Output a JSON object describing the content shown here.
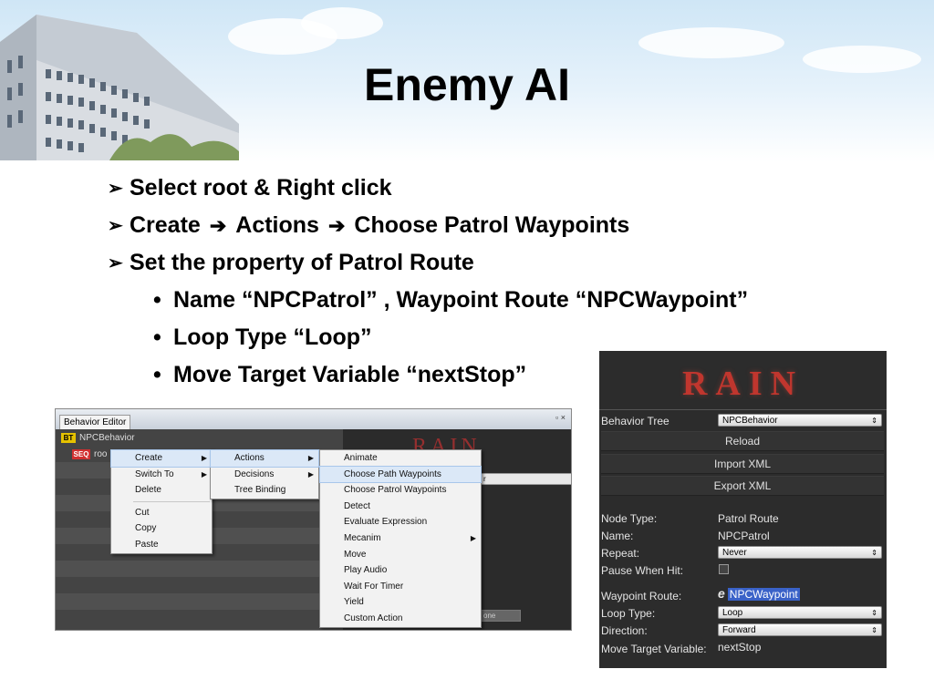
{
  "slide": {
    "title": "Enemy AI",
    "bullets": [
      {
        "text": "Select root & Right click"
      },
      {
        "parts": [
          "Create",
          "Actions",
          "Choose Patrol Waypoints"
        ]
      },
      {
        "text": "Set the property of Patrol Route"
      }
    ],
    "subbullets": [
      "Name “NPCPatrol” , Waypoint Route “NPCWaypoint”",
      "Loop Type “Loop”",
      "Move Target Variable “nextStop”"
    ]
  },
  "editor": {
    "tab": "Behavior Editor",
    "window_controls": "▫ ×",
    "root_icon": "BT",
    "root_label": "NPCBehavior",
    "child_icon": "SEQ",
    "child_label": "roo",
    "menu1": {
      "items": [
        "Create",
        "Switch To",
        "Delete"
      ],
      "items2": [
        "Cut",
        "Copy",
        "Paste"
      ]
    },
    "menu2": {
      "items": [
        "Actions",
        "Decisions",
        "Tree Binding"
      ]
    },
    "menu3": {
      "items": [
        "Animate",
        "Choose Path Waypoints",
        "Choose Patrol Waypoints",
        "Detect",
        "Evaluate Expression",
        "Mecanim",
        "Move",
        "Play Audio",
        "Wait For Timer",
        "Yield",
        "Custom Action"
      ]
    },
    "bg_logo": "RAIN",
    "bg_dropdown": "r",
    "bg_footer": "one"
  },
  "inspector": {
    "logo": "RAIN",
    "behavior_tree_label": "Behavior Tree",
    "behavior_tree_value": "NPCBehavior",
    "reload": "Reload",
    "import_xml": "Import XML",
    "export_xml": "Export XML",
    "node_type_label": "Node Type:",
    "node_type_value": "Patrol Route",
    "name_label": "Name:",
    "name_value": "NPCPatrol",
    "repeat_label": "Repeat:",
    "repeat_value": "Never",
    "pause_label": "Pause When Hit:",
    "pause_checked": false,
    "waypoint_label": "Waypoint Route:",
    "waypoint_icon": "e",
    "waypoint_value": "NPCWaypoint",
    "loop_label": "Loop Type:",
    "loop_value": "Loop",
    "direction_label": "Direction:",
    "direction_value": "Forward",
    "move_target_label": "Move Target Variable:",
    "move_target_value": "nextStop"
  },
  "colors": {
    "rain_red": "#c0362e",
    "highlight": "#3a62c8"
  }
}
